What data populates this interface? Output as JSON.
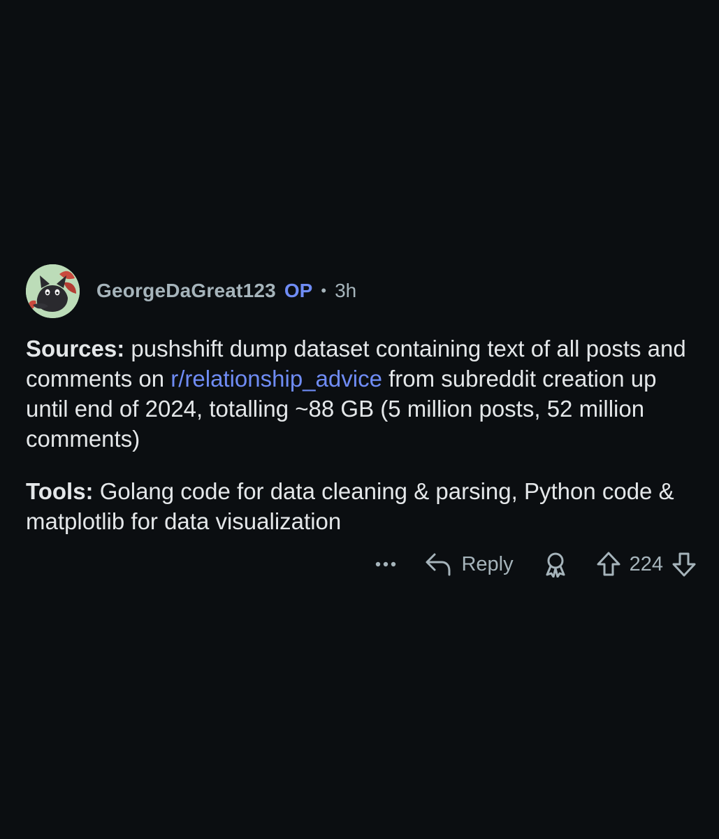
{
  "comment": {
    "author": "GeorgeDaGreat123",
    "op_badge": "OP",
    "separator": "•",
    "time": "3h",
    "sources_label": "Sources:",
    "sources_text_1": " pushshift dump dataset containing text of all posts and comments on ",
    "sources_link": "r/relationship_advice",
    "sources_text_2": " from subreddit creation up until end of 2024, totalling ~88 GB (5 million posts, 52 million comments)",
    "tools_label": "Tools:",
    "tools_text": " Golang code for data cleaning & parsing, Python code & matplotlib for data visualization"
  },
  "actions": {
    "more_icon": "ellipsis-icon",
    "reply_label": "Reply",
    "reply_icon": "reply-arrow-icon",
    "award_icon": "award-icon",
    "upvote_icon": "upvote-arrow-icon",
    "vote_count": "224",
    "downvote_icon": "downvote-arrow-icon"
  },
  "colors": {
    "background": "#0b0e11",
    "link": "#6f8cf5",
    "muted": "#a6b4bb",
    "text": "#e4e7e9"
  }
}
